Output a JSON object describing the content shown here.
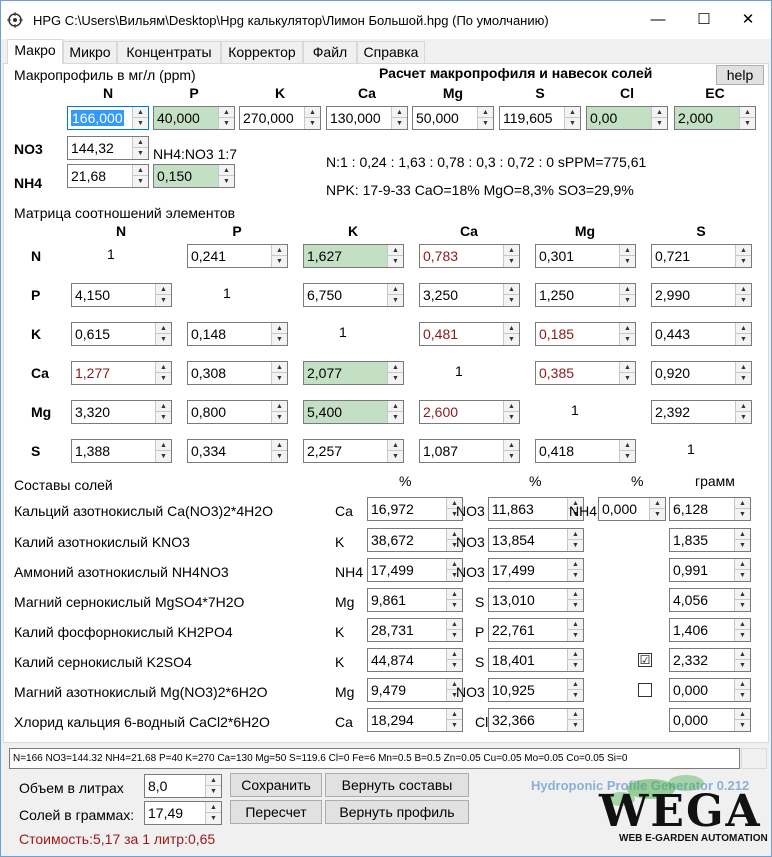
{
  "window": {
    "title": "HPG C:\\Users\\Вильям\\Desktop\\Hpg калькулятор\\Лимон Большой.hpg (По умолчанию)",
    "minimize": "—",
    "maximize": "☐",
    "close": "✕"
  },
  "tabs": [
    "Макро",
    "Микро",
    "Концентраты",
    "Корректор",
    "Файл",
    "Справка"
  ],
  "macro": {
    "heading": "Макропрофиль в мг/л (ppm)",
    "calc_title": "Расчет макропрофиля и навесок солей",
    "help": "help",
    "cols": [
      "N",
      "P",
      "K",
      "Ca",
      "Mg",
      "S",
      "Cl",
      "EC"
    ],
    "values": [
      "166,000",
      "40,000",
      "270,000",
      "130,000",
      "50,000",
      "119,605",
      "0,00",
      "2,000"
    ],
    "no3_label": "NO3",
    "no3": "144,32",
    "nh4_label": "NH4",
    "nh4": "21,68",
    "ratio_label": "NH4:NO3 1:7",
    "ratio_val": "0,150",
    "ratio_line": "N:1 : 0,24 : 1,63 : 0,78 : 0,3 : 0,72 : 0 sPPM=775,61",
    "npk_line": "NPK: 17-9-33 CaO=18% MgO=8,3% SO3=29,9%"
  },
  "matrix": {
    "heading": "Матрица соотношений элементов",
    "cols": [
      "N",
      "P",
      "K",
      "Ca",
      "Mg",
      "S"
    ],
    "rows": [
      "N",
      "P",
      "K",
      "Ca",
      "Mg",
      "S"
    ],
    "cells": [
      [
        "1",
        "0,241",
        "1,627",
        "0,783",
        "0,301",
        "0,721"
      ],
      [
        "4,150",
        "1",
        "6,750",
        "3,250",
        "1,250",
        "2,990"
      ],
      [
        "0,615",
        "0,148",
        "1",
        "0,481",
        "0,185",
        "0,443"
      ],
      [
        "1,277",
        "0,308",
        "2,077",
        "1",
        "0,385",
        "0,920"
      ],
      [
        "3,320",
        "0,800",
        "5,400",
        "2,600",
        "1",
        "2,392"
      ],
      [
        "1,388",
        "0,334",
        "2,257",
        "1,087",
        "0,418",
        "1"
      ]
    ]
  },
  "salts": {
    "heading": "Составы солей",
    "pct1": "%",
    "pct2": "%",
    "pct3": "%",
    "gram": "грамм",
    "rows": [
      {
        "name": "Кальций азотнокислый Ca(NO3)2*4H2O",
        "e1": "Ca",
        "v1": "16,972",
        "e2": "NO3",
        "v2": "11,863",
        "e3": "NH4",
        "v3": "0,000",
        "g": "6,128"
      },
      {
        "name": "Калий азотнокислый KNO3",
        "e1": "K",
        "v1": "38,672",
        "e2": "NO3",
        "v2": "13,854",
        "g": "1,835"
      },
      {
        "name": "Аммоний азотнокислый NH4NO3",
        "e1": "NH4",
        "v1": "17,499",
        "e2": "NO3",
        "v2": "17,499",
        "g": "0,991"
      },
      {
        "name": "Магний сернокислый MgSO4*7H2O",
        "e1": "Mg",
        "v1": "9,861",
        "e2": "S",
        "v2": "13,010",
        "g": "4,056"
      },
      {
        "name": "Калий фосфорнокислый KH2PO4",
        "e1": "K",
        "v1": "28,731",
        "e2": "P",
        "v2": "22,761",
        "g": "1,406"
      },
      {
        "name": "Калий сернокислый K2SO4",
        "e1": "K",
        "v1": "44,874",
        "e2": "S",
        "v2": "18,401",
        "chk": "☑",
        "g": "2,332"
      },
      {
        "name": "Магний азотнокислый Mg(NO3)2*6H2O",
        "e1": "Mg",
        "v1": "9,479",
        "e2": "NO3",
        "v2": "10,925",
        "chk": "",
        "g": "0,000"
      },
      {
        "name": "Хлорид кальция 6-водный CaCl2*6H2O",
        "e1": "Ca",
        "v1": "18,294",
        "e2": "Cl",
        "v2": "32,366",
        "g": "0,000"
      }
    ]
  },
  "status": "N=166 NO3=144.32 NH4=21.68 P=40 K=270 Ca=130 Mg=50 S=119.6 Cl=0 Fe=6 Mn=0.5 B=0.5 Zn=0.05 Cu=0.05 Mo=0.05 Co=0.05 Si=0",
  "bottom": {
    "volume_label": "Объем в литрах",
    "volume": "8,0",
    "salts_label": "Солей в граммах:",
    "salts": "17,49",
    "save": "Сохранить",
    "recalc": "Пересчет",
    "restore_comp": "Вернуть составы",
    "restore_prof": "Вернуть профиль",
    "cost": "Стоимость:5,17 за 1 литр:0,65",
    "generator": "Hydroponic Profile Generator 0.212",
    "logo": "WEGA",
    "logo_sub": "WEB E-GARDEN AUTOMATION"
  },
  "colors": {
    "green_field": "#c4e0c4",
    "red_value": "#8b1a1a",
    "cost": "#a01818",
    "logo_green": "#4caf50"
  }
}
